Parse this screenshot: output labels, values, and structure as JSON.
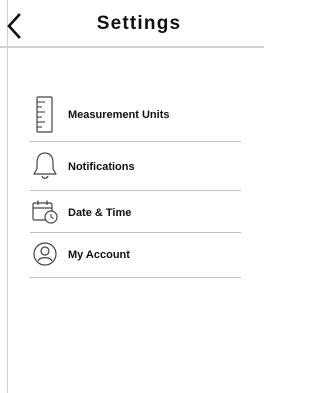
{
  "header": {
    "title": "Settings",
    "back_icon": "chevron-left-icon"
  },
  "menu": {
    "items": [
      {
        "label": "Measurement Units",
        "icon": "ruler-icon"
      },
      {
        "label": "Notifications",
        "icon": "bell-icon"
      },
      {
        "label": "Date & Time",
        "icon": "calendar-clock-icon"
      },
      {
        "label": "My Account",
        "icon": "user-circle-icon"
      }
    ]
  },
  "colors": {
    "text": "#111111",
    "divider": "#bfbfbf",
    "icon_stroke": "#444444"
  }
}
